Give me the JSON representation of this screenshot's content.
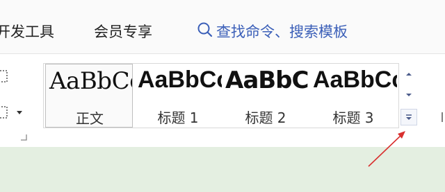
{
  "menu": {
    "developer_tools": "开发工具",
    "vip": "会员专享",
    "search_label": "查找命令、搜索模板"
  },
  "styles": {
    "preview_text": "AaBbCc",
    "items": [
      {
        "label": "正文",
        "selected": true
      },
      {
        "label": "标题 1",
        "selected": false
      },
      {
        "label": "标题 2",
        "selected": false
      },
      {
        "label": "标题 3",
        "selected": false
      }
    ]
  },
  "colors": {
    "accent_blue": "#3b5fb8",
    "annotation_red": "#d9302f",
    "ribbon_bottom": "#e4efe1"
  },
  "icons": {
    "search": "search-icon",
    "scroll_up": "scroll-up-icon",
    "scroll_down": "scroll-down-icon",
    "more_styles": "more-styles-icon"
  }
}
